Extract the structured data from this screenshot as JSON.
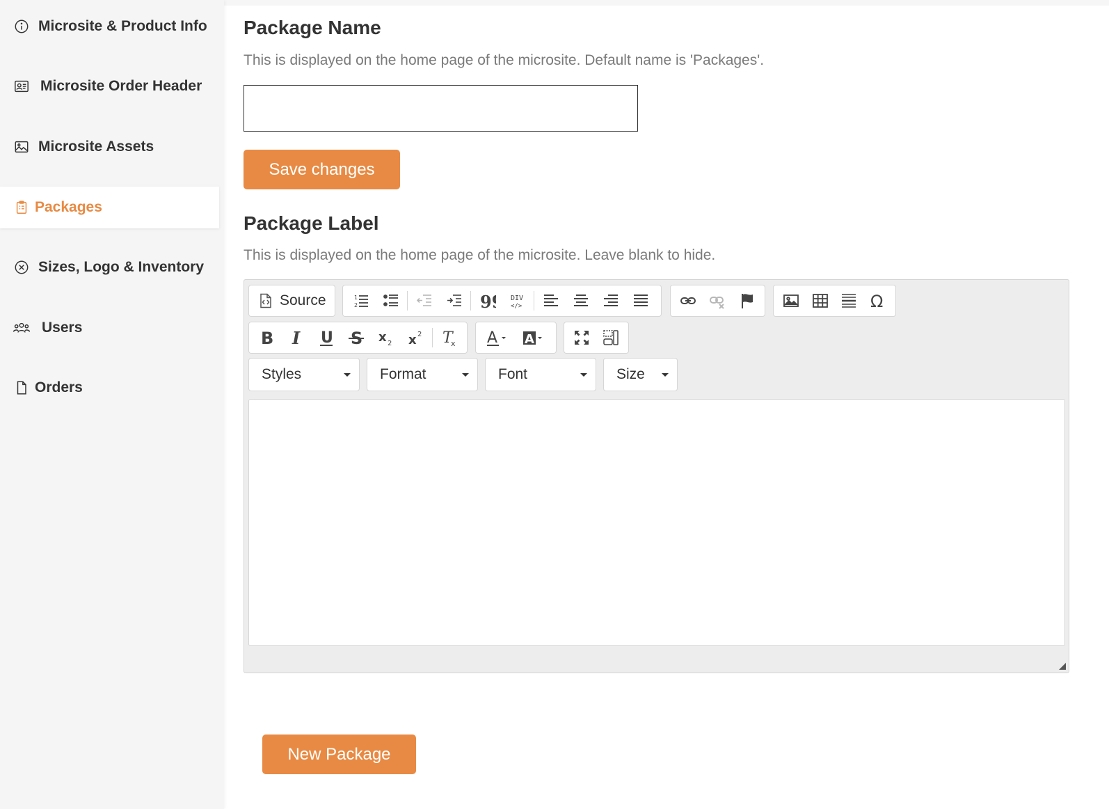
{
  "sidebar": {
    "items": [
      {
        "label": "Microsite & Product Info",
        "icon": "info-icon"
      },
      {
        "label": "Microsite Order Header",
        "icon": "id-card-icon"
      },
      {
        "label": "Microsite Assets",
        "icon": "image-icon"
      },
      {
        "label": "Packages",
        "icon": "clipboard-icon",
        "active": true
      },
      {
        "label": "Sizes, Logo & Inventory",
        "icon": "circle-x-icon"
      },
      {
        "label": "Users",
        "icon": "users-icon"
      },
      {
        "label": "Orders",
        "icon": "file-icon"
      }
    ]
  },
  "package_name": {
    "title": "Package Name",
    "description": "This is displayed on the home page of the microsite. Default name is 'Packages'.",
    "value": "",
    "save_label": "Save changes"
  },
  "package_label": {
    "title": "Package Label",
    "description": "This is displayed on the home page of the microsite. Leave blank to hide.",
    "editor": {
      "source_label": "Source",
      "combos": [
        "Styles",
        "Format",
        "Font",
        "Size"
      ],
      "content": ""
    }
  },
  "new_package_label": "New Package",
  "colors": {
    "accent": "#e88a43",
    "sidebar_bg": "#f5f5f5",
    "toolbar_bg": "#ededed"
  }
}
